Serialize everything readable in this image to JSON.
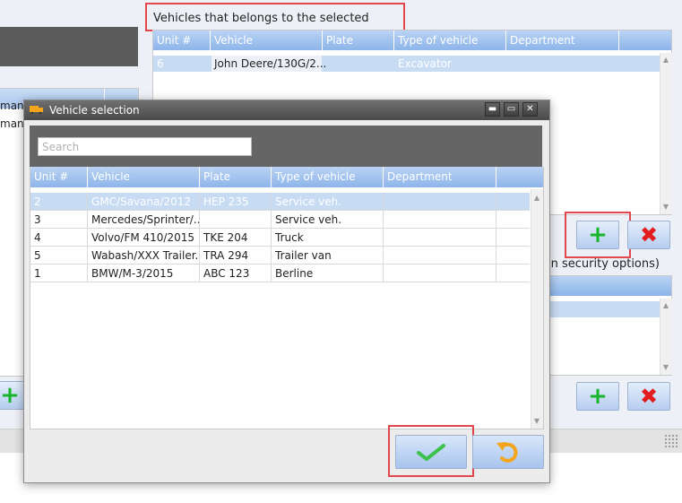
{
  "background": {
    "group_vehicles_label": "Vehicles that belongs to the selected group",
    "left_rows": [
      "mana",
      "mana"
    ],
    "group_grid": {
      "columns": [
        "Unit #",
        "Vehicle",
        "Plate",
        "Type of vehicle",
        "Department"
      ],
      "rows": [
        {
          "unit": "6",
          "vehicle": "John Deere/130G/2...",
          "plate": "",
          "type": "Excavator",
          "department": ""
        }
      ]
    },
    "security_text": "in security options)",
    "add_symbol": "+",
    "delete_symbol": "✖",
    "accent_green": "#18b52c",
    "accent_red": "#e31d1d",
    "highlight_red": "#e2474e"
  },
  "dialog": {
    "title": "Vehicle selection",
    "title_icon": "truck-icon",
    "controls": {
      "minimize": "▬",
      "maximize": "▭",
      "close": "✕"
    },
    "search_placeholder": "Search",
    "grid": {
      "columns": [
        "Unit #",
        "Vehicle",
        "Plate",
        "Type of vehicle",
        "Department"
      ],
      "rows": [
        {
          "unit": "2",
          "vehicle": "GMC/Savana/2012",
          "plate": "HEP 235",
          "type": "Service veh.",
          "department": "",
          "selected": true
        },
        {
          "unit": "3",
          "vehicle": "Mercedes/Sprinter/...",
          "plate": "",
          "type": "Service veh.",
          "department": ""
        },
        {
          "unit": "4",
          "vehicle": "Volvo/FM 410/2015",
          "plate": "TKE 204",
          "type": "Truck",
          "department": ""
        },
        {
          "unit": "5",
          "vehicle": "Wabash/XXX Trailer...",
          "plate": "TRA 294",
          "type": "Trailer van",
          "department": ""
        },
        {
          "unit": "1",
          "vehicle": "BMW/M-3/2015",
          "plate": "ABC 123",
          "type": "Berline",
          "department": ""
        }
      ]
    },
    "ok_icon": "checkmark-icon",
    "undo_icon": "undo-icon"
  }
}
